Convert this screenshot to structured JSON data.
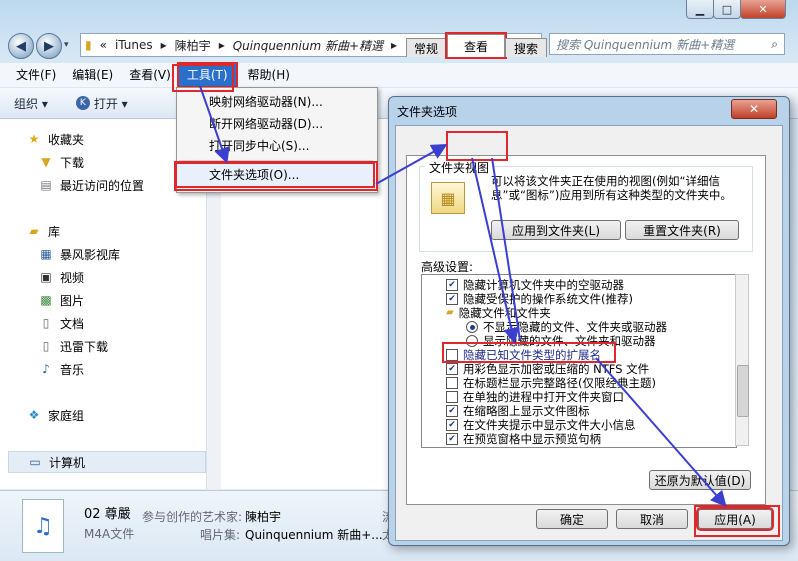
{
  "explorer": {
    "breadcrumb": [
      "iTunes",
      "陳柏宇",
      "Quinquennium 新曲+精選"
    ],
    "breadcrumb_prefix": "«",
    "search_placeholder": "搜索 Quinquennium 新曲+精選",
    "menu": [
      "文件(F)",
      "编辑(E)",
      "查看(V)",
      "工具(T)",
      "帮助(H)"
    ],
    "toolbar": {
      "organize": "组织 ▾",
      "open": "打开 ▾"
    },
    "nav": {
      "favorites": "收藏夹",
      "downloads": "下载",
      "recent": "最近访问的位置",
      "libraries": "库",
      "baofeng": "暴风影视库",
      "video": "视频",
      "pictures": "图片",
      "documents": "文档",
      "xunlei": "迅雷下载",
      "music": "音乐",
      "homegroup": "家庭组",
      "computer": "计算机"
    },
    "details": {
      "title": "02 尊嚴",
      "type": "M4A文件",
      "artist_label": "参与创作的艺术家:",
      "artist": "陳柏宇",
      "album_label": "唱片集:",
      "album": "Quinquennium 新曲+...",
      "extra1": "流",
      "extra2": "太"
    }
  },
  "tools_menu": {
    "items": [
      "映射网络驱动器(N)...",
      "断开网络驱动器(D)...",
      "打开同步中心(S)...",
      "文件夹选项(O)..."
    ]
  },
  "dialog": {
    "title": "文件夹选项",
    "close": "✕",
    "tabs": [
      "常规",
      "查看",
      "搜索"
    ],
    "folder_view_label": "文件夹视图",
    "folder_view_desc": "可以将该文件夹正在使用的视图(例如“详细信息”或“图标”)应用到所有这种类型的文件夹中。",
    "apply_to_folders": "应用到文件夹(L)",
    "reset_folders": "重置文件夹(R)",
    "advanced_label": "高级设置:",
    "settings": [
      {
        "text": "隐藏计算机文件夹中的空驱动器",
        "kind": "check",
        "checked": true
      },
      {
        "text": "隐藏受保护的操作系统文件(推荐)",
        "kind": "check",
        "checked": true
      },
      {
        "text": "隐藏文件和文件夹",
        "kind": "folder"
      },
      {
        "text": "不显示隐藏的文件、文件夹或驱动器",
        "kind": "radio",
        "checked": true
      },
      {
        "text": "显示隐藏的文件、文件夹和驱动器",
        "kind": "radio",
        "checked": false
      },
      {
        "text": "隐藏已知文件类型的扩展名",
        "kind": "check",
        "checked": false
      },
      {
        "text": "用彩色显示加密或压缩的 NTFS 文件",
        "kind": "check",
        "checked": true
      },
      {
        "text": "在标题栏显示完整路径(仅限经典主题)",
        "kind": "check",
        "checked": false
      },
      {
        "text": "在单独的进程中打开文件夹窗口",
        "kind": "check",
        "checked": false
      },
      {
        "text": "在缩略图上显示文件图标",
        "kind": "check",
        "checked": true
      },
      {
        "text": "在文件夹提示中显示文件大小信息",
        "kind": "check",
        "checked": true
      },
      {
        "text": "在预览窗格中显示预览句柄",
        "kind": "check",
        "checked": true
      }
    ],
    "restore_defaults": "还原为默认值(D)",
    "ok": "确定",
    "cancel": "取消",
    "apply": "应用(A)"
  },
  "colors": {
    "highlight_red": "#e0272b",
    "arrow_blue": "#3a3fd0",
    "menu_selected": "#2a6fc9"
  }
}
